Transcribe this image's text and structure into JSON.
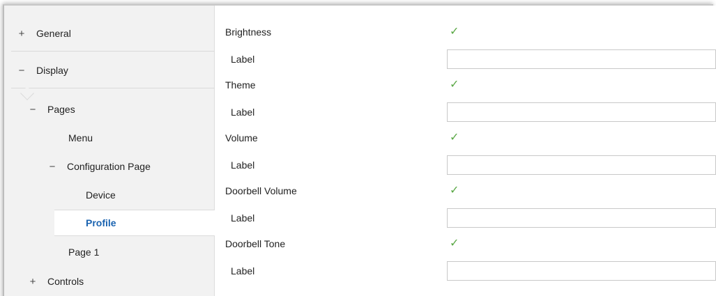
{
  "sidebar": {
    "items": [
      {
        "glyph": "+",
        "label": "General"
      },
      {
        "glyph": "−",
        "label": "Display"
      },
      {
        "glyph": "−",
        "label": "Pages"
      },
      {
        "glyph": "",
        "label": "Menu"
      },
      {
        "glyph": "−",
        "label": "Configuration Page"
      },
      {
        "glyph": "",
        "label": "Device"
      },
      {
        "glyph": "",
        "label": "Profile"
      },
      {
        "glyph": "",
        "label": "Page 1"
      },
      {
        "glyph": "+",
        "label": "Controls"
      }
    ],
    "selected": "Profile"
  },
  "settings": {
    "rows": [
      {
        "label": "Brightness",
        "checked": true,
        "sub_label": "Label",
        "value": ""
      },
      {
        "label": "Theme",
        "checked": true,
        "sub_label": "Label",
        "value": ""
      },
      {
        "label": "Volume",
        "checked": true,
        "sub_label": "Label",
        "value": ""
      },
      {
        "label": "Doorbell Volume",
        "checked": true,
        "sub_label": "Label",
        "value": ""
      },
      {
        "label": "Doorbell Tone",
        "checked": true,
        "sub_label": "Label",
        "value": ""
      }
    ],
    "check_glyph": "✓",
    "check_color": "#5aa845"
  },
  "colors": {
    "sidebar_bg": "#f2f2f2",
    "selected_text": "#1a63b0"
  }
}
